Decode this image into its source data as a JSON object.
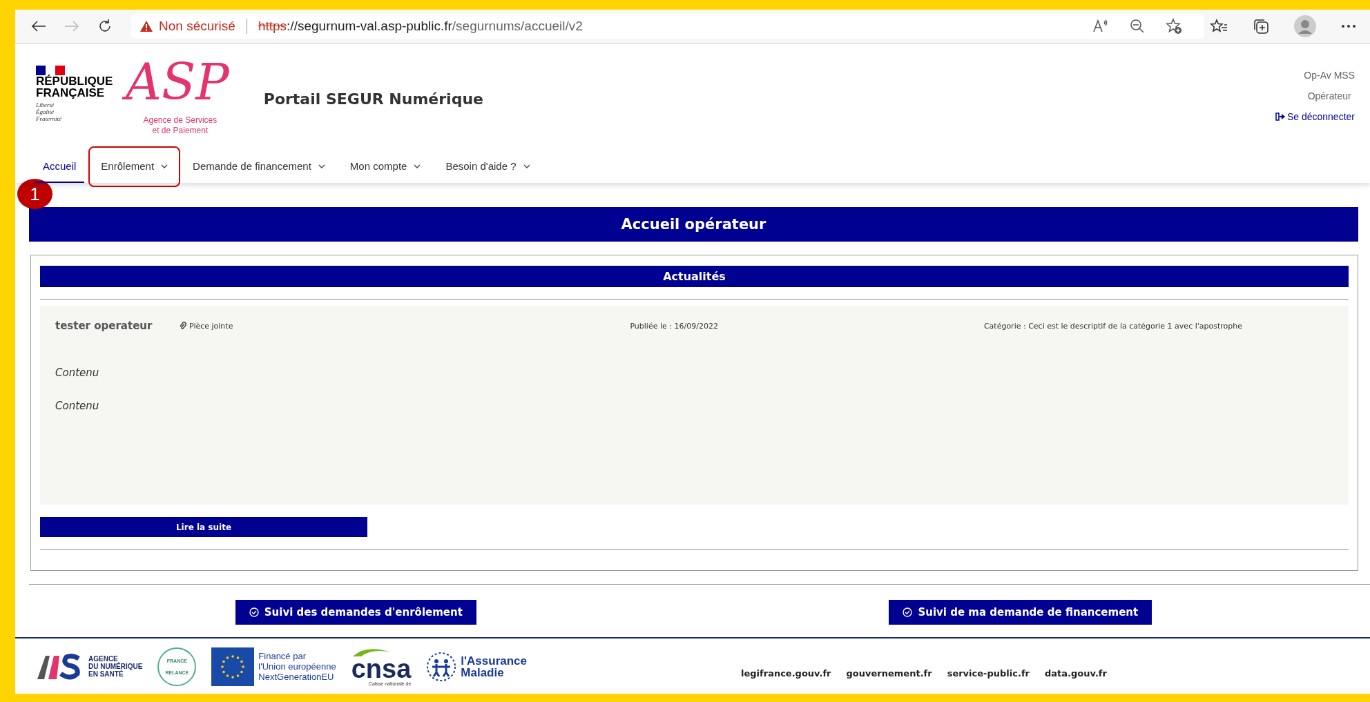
{
  "browser": {
    "security_warning": "Non sécurisé",
    "url_scheme": "https",
    "url_host": "://segurnum-val.asp-public.fr",
    "url_path": "/segurnums/accueil/v2",
    "forward_disabled": true
  },
  "header": {
    "republic": [
      "RÉPUBLIQUE",
      "FRANÇAISE"
    ],
    "motto": [
      "Liberté",
      "Égalité",
      "Fraternité"
    ],
    "asp_logo": "ASP",
    "asp_name": [
      "Agence de Services",
      "et de Paiement"
    ],
    "portal_title": "Portail SEGUR Numérique",
    "user": {
      "name": "Op-Av MSS",
      "role": "Opérateur",
      "logout": "Se déconnecter"
    }
  },
  "nav": [
    {
      "label": "Accueil",
      "selected": true,
      "dropdown": false,
      "highlighted": false
    },
    {
      "label": "Enrôlement",
      "selected": false,
      "dropdown": true,
      "highlighted": true
    },
    {
      "label": "Demande de financement",
      "selected": false,
      "dropdown": true,
      "highlighted": false
    },
    {
      "label": "Mon compte",
      "selected": false,
      "dropdown": true,
      "highlighted": false
    },
    {
      "label": "Besoin d'aide ?",
      "selected": false,
      "dropdown": true,
      "highlighted": false
    }
  ],
  "callout": {
    "label": "1"
  },
  "page_title": "Accueil opérateur",
  "news": {
    "title": "Actualités",
    "items": [
      {
        "author": "tester operateur",
        "attachment": "Pièce jointe",
        "published": "Publiée le : 16/09/2022",
        "category": "Catégorie : Ceci est le descriptif de la catégorie 1 avec l'apostrophe",
        "paragraphs": [
          "Contenu",
          "Contenu"
        ]
      }
    ],
    "read_more": "Lire la suite"
  },
  "actions": [
    "Suivi des demandes d'enrôlement",
    "Suivi de ma demande de financement"
  ],
  "footer": {
    "partners": [
      {
        "kind": "ans",
        "lines": [
          "AGENCE",
          "DU NUMÉRIQUE",
          "EN SANTÉ"
        ]
      },
      {
        "kind": "relance",
        "lines": [
          "FRANCE",
          "RELANCE"
        ]
      },
      {
        "kind": "eu",
        "lines": [
          "Financé par",
          "l'Union européenne",
          "NextGenerationEU"
        ]
      },
      {
        "kind": "cnsa",
        "lines": [
          "cnsa",
          "Caisse nationale de"
        ]
      },
      {
        "kind": "ameli",
        "lines": [
          "l'Assurance",
          "Maladie"
        ]
      }
    ],
    "links": [
      "legifrance.gouv.fr",
      "gouvernement.fr",
      "service-public.fr",
      "data.gouv.fr"
    ]
  }
}
